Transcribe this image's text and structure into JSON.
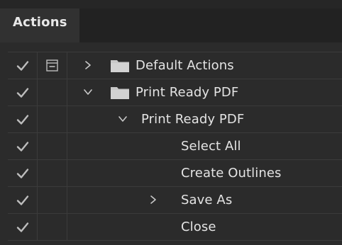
{
  "panel": {
    "tab_label": "Actions"
  },
  "rows": [
    {
      "label": "Default Actions"
    },
    {
      "label": "Print Ready PDF"
    },
    {
      "label": "Print Ready PDF"
    },
    {
      "label": "Select All"
    },
    {
      "label": "Create Outlines"
    },
    {
      "label": "Save As"
    },
    {
      "label": "Close"
    }
  ],
  "colors": {
    "background": "#2b2b2b",
    "tab_active": "#313131",
    "text": "#e4e4e4",
    "icon": "#c8c8c8"
  }
}
